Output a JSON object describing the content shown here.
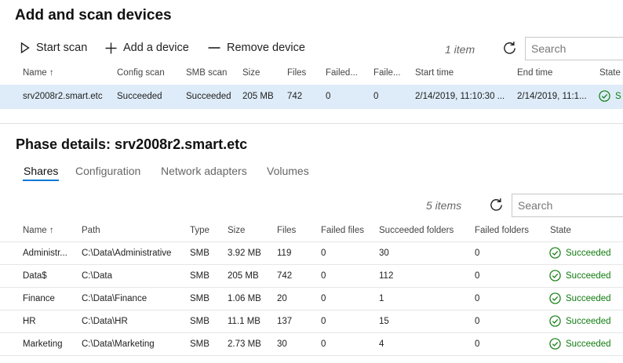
{
  "page_title": "Add and scan devices",
  "toolbar": {
    "start_scan": "Start scan",
    "add_device": "Add a device",
    "remove_device": "Remove device",
    "item_count": "1 item",
    "search_placeholder": "Search"
  },
  "devices_table": {
    "headers": [
      "Name ↑",
      "Config scan",
      "SMB scan",
      "Size",
      "Files",
      "Failed...",
      "Faile...",
      "Start time",
      "End time",
      "State"
    ],
    "rows": [
      {
        "name": "srv2008r2.smart.etc",
        "config_scan": "Succeeded",
        "smb_scan": "Succeeded",
        "size": "205 MB",
        "files": "742",
        "failed1": "0",
        "failed2": "0",
        "start_time": "2/14/2019, 11:10:30 ...",
        "end_time": "2/14/2019, 11:1...",
        "state": "S"
      }
    ]
  },
  "phase": {
    "title": "Phase details: srv2008r2.smart.etc",
    "tabs": [
      "Shares",
      "Configuration",
      "Network adapters",
      "Volumes"
    ],
    "item_count": "5 items",
    "search_placeholder": "Search"
  },
  "shares_table": {
    "headers": [
      "Name ↑",
      "Path",
      "Type",
      "Size",
      "Files",
      "Failed files",
      "Succeeded folders",
      "Failed folders",
      "State"
    ],
    "rows": [
      {
        "name": "Administr...",
        "path": "C:\\Data\\Administrative",
        "type": "SMB",
        "size": "3.92 MB",
        "files": "119",
        "failed_files": "0",
        "succeeded_folders": "30",
        "failed_folders": "0",
        "state": "Succeeded"
      },
      {
        "name": "Data$",
        "path": "C:\\Data",
        "type": "SMB",
        "size": "205 MB",
        "files": "742",
        "failed_files": "0",
        "succeeded_folders": "112",
        "failed_folders": "0",
        "state": "Succeeded"
      },
      {
        "name": "Finance",
        "path": "C:\\Data\\Finance",
        "type": "SMB",
        "size": "1.06 MB",
        "files": "20",
        "failed_files": "0",
        "succeeded_folders": "1",
        "failed_folders": "0",
        "state": "Succeeded"
      },
      {
        "name": "HR",
        "path": "C:\\Data\\HR",
        "type": "SMB",
        "size": "11.1 MB",
        "files": "137",
        "failed_files": "0",
        "succeeded_folders": "15",
        "failed_folders": "0",
        "state": "Succeeded"
      },
      {
        "name": "Marketing",
        "path": "C:\\Data\\Marketing",
        "type": "SMB",
        "size": "2.73 MB",
        "files": "30",
        "failed_files": "0",
        "succeeded_folders": "4",
        "failed_folders": "0",
        "state": "Succeeded"
      }
    ]
  },
  "colors": {
    "accent": "#0078d4",
    "success": "#107c10",
    "selected_row": "#deecf9"
  },
  "icons": {
    "start_scan": "play-icon",
    "add_device": "plus-icon",
    "remove_device": "minus-icon",
    "refresh": "refresh-icon",
    "state_ok": "check-circle-icon"
  }
}
